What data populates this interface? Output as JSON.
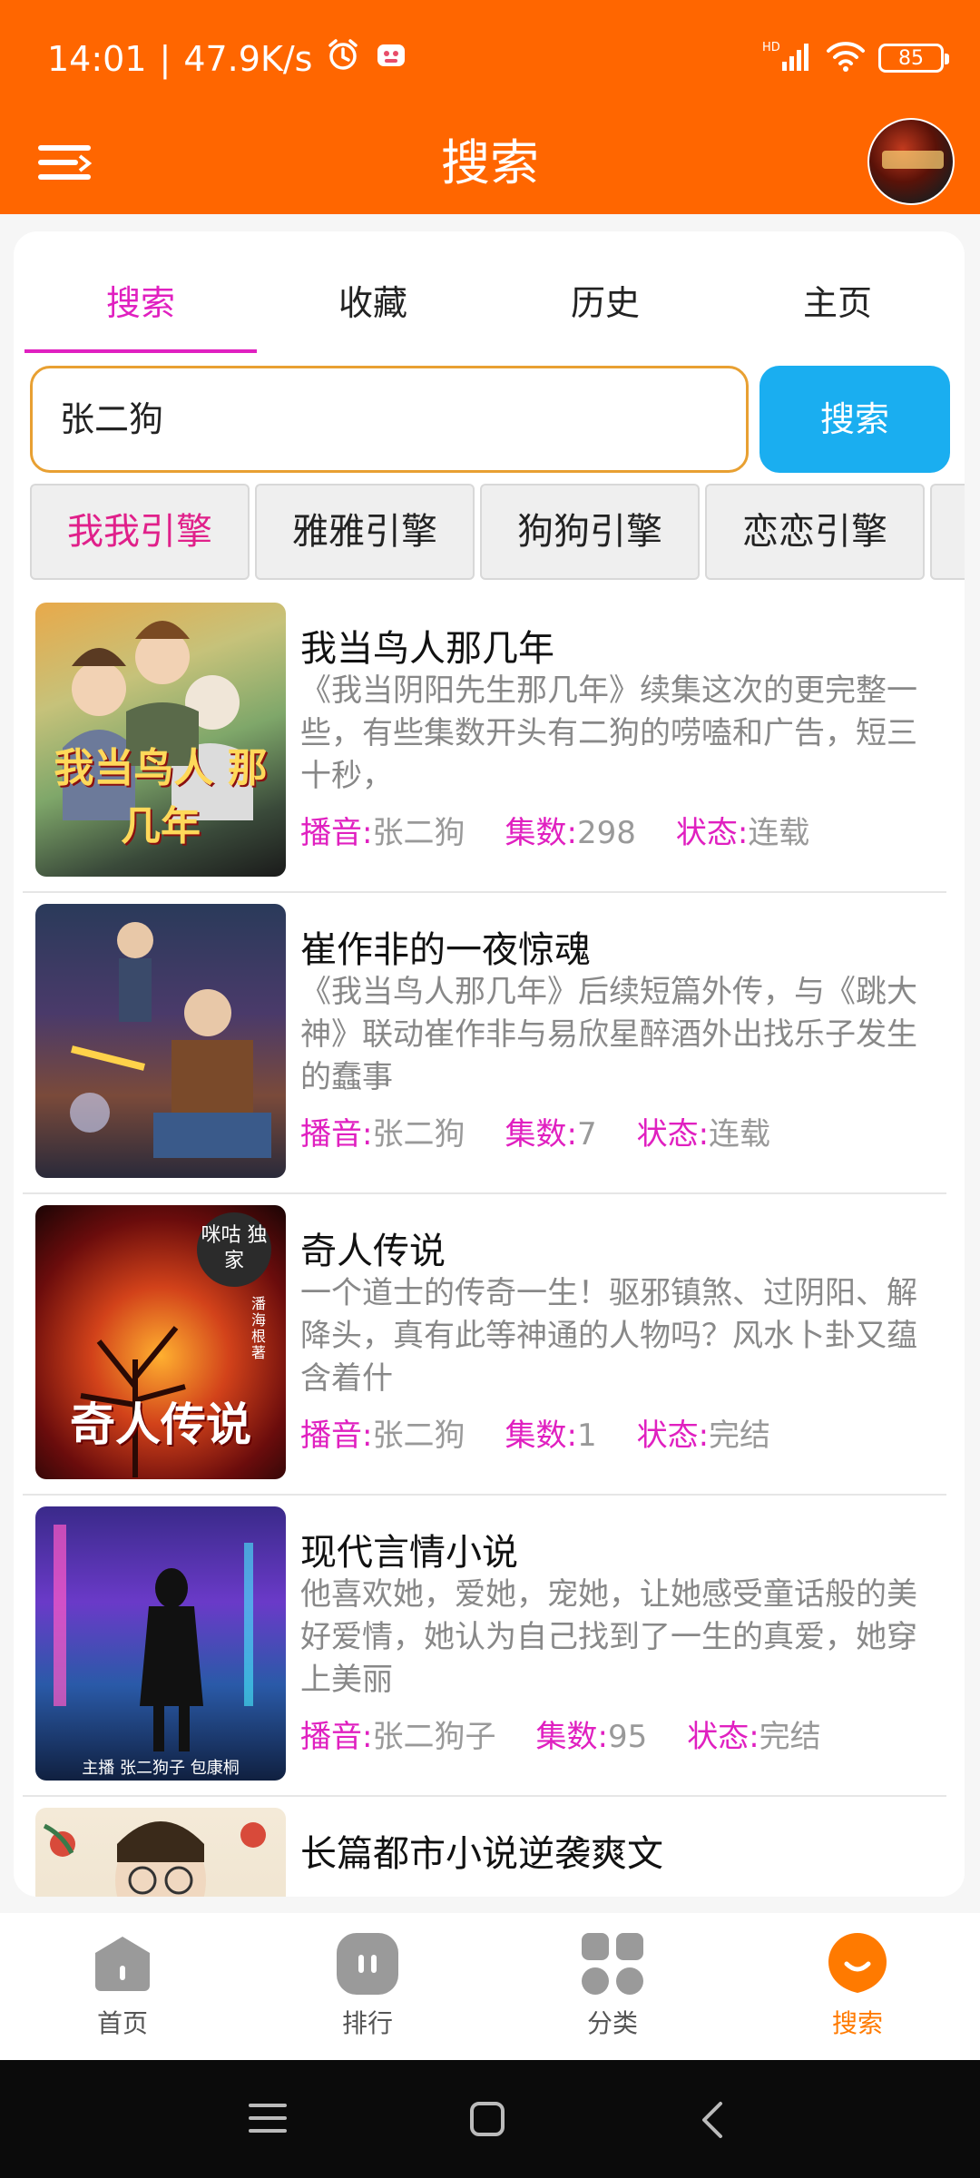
{
  "status_bar": {
    "time": "14:01",
    "separator": "|",
    "speed": "47.9K/s",
    "battery": "85",
    "network": "HD"
  },
  "app_bar": {
    "title": "搜索",
    "menu_icon": "hamburger-menu-icon",
    "avatar_icon": "avatar"
  },
  "tabs": [
    {
      "label": "搜索",
      "active": true
    },
    {
      "label": "收藏",
      "active": false
    },
    {
      "label": "历史",
      "active": false
    },
    {
      "label": "主页",
      "active": false
    }
  ],
  "search": {
    "value": "张二狗",
    "button_label": "搜索"
  },
  "engines": [
    {
      "label": "我我引擎",
      "active": true
    },
    {
      "label": "雅雅引擎",
      "active": false
    },
    {
      "label": "狗狗引擎",
      "active": false
    },
    {
      "label": "恋恋引擎",
      "active": false
    }
  ],
  "meta_labels": {
    "narrator": "播音:",
    "episodes": "集数:",
    "status": "状态:"
  },
  "results": [
    {
      "title": "我当鸟人那几年",
      "cover_text": "我当鸟人 那几年",
      "description": "《我当阴阳先生那几年》续集这次的更完整一些，有些集数开头有二狗的唠嗑和广告，短三十秒，",
      "narrator": "张二狗",
      "episodes": "298",
      "status": "连载"
    },
    {
      "title": "崔作非的一夜惊魂",
      "cover_text": "",
      "description": "《我当鸟人那几年》后续短篇外传，与《跳大神》联动崔作非与易欣星醉酒外出找乐子发生的蠢事",
      "narrator": "张二狗",
      "episodes": "7",
      "status": "连载"
    },
    {
      "title": "奇人传说",
      "cover_text": "奇人传说",
      "cover_badge": "咪咕 独家",
      "cover_author": "潘海根 著",
      "description": "一个道士的传奇一生！驱邪镇煞、过阴阳、解降头，真有此等神通的人物吗？风水卜卦又蕴含着什",
      "narrator": "张二狗",
      "episodes": "1",
      "status": "完结"
    },
    {
      "title": "现代言情小说",
      "cover_text": "主播 张二狗子  包康桐",
      "description": "他喜欢她，爱她，宠她，让她感受童话般的美好爱情，她认为自己找到了一生的真爱，她穿上美丽",
      "narrator": "张二狗子",
      "episodes": "95",
      "status": "完结"
    },
    {
      "title": "长篇都市小说逆袭爽文",
      "cover_text": "",
      "description": "",
      "narrator": "",
      "episodes": "",
      "status": ""
    }
  ],
  "bottom_nav": [
    {
      "label": "首页",
      "icon": "home-icon",
      "active": false
    },
    {
      "label": "排行",
      "icon": "rank-icon",
      "active": false
    },
    {
      "label": "分类",
      "icon": "category-icon",
      "active": false
    },
    {
      "label": "搜索",
      "icon": "search-nav-icon",
      "active": true
    }
  ],
  "colors": {
    "primary": "#FF6600",
    "accent_pink": "#E020C0",
    "search_button": "#1AAEF0",
    "input_border": "#E8A032",
    "nav_active": "#FF7A00"
  }
}
